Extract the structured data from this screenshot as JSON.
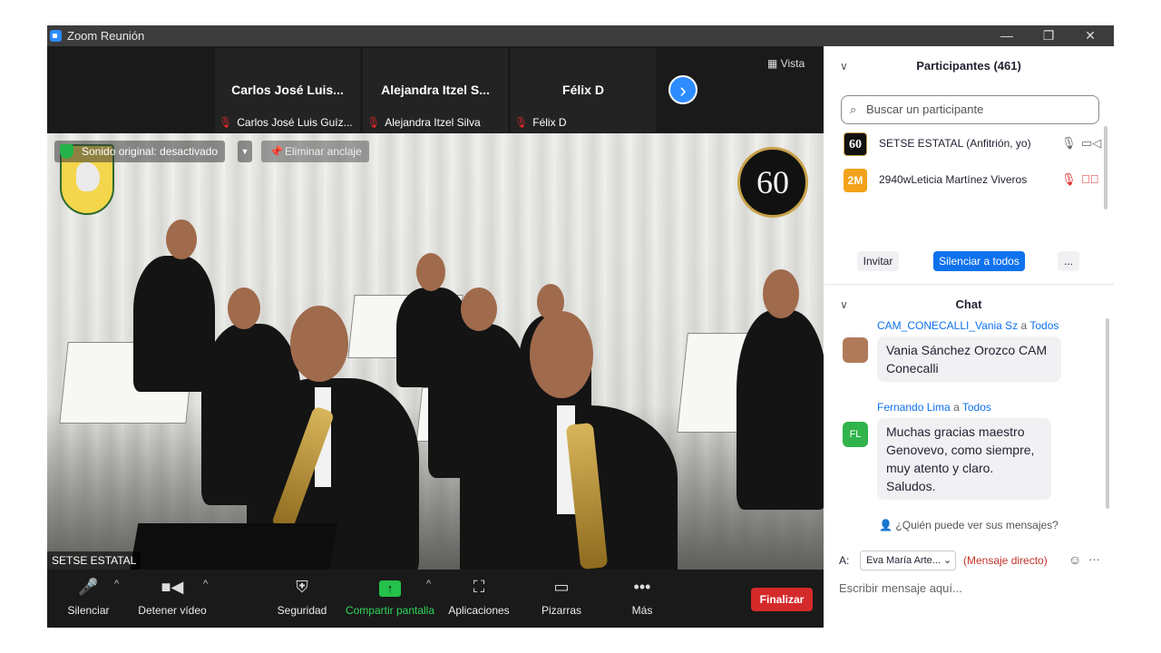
{
  "window": {
    "title": "Zoom Reunión",
    "minimize": "—",
    "maximize": "❐",
    "close": "✕"
  },
  "thumbnails": [
    {
      "name": "Carlos José Luis...",
      "label": "Carlos José Luis Guíz..."
    },
    {
      "name": "Alejandra Itzel S...",
      "label": "Alejandra Itzel Silva"
    },
    {
      "name": "Félix D",
      "label": "Félix D"
    }
  ],
  "view_label": "Vista",
  "video": {
    "sound_original": "Sonido original: desactivado",
    "unpin": "Eliminar anclaje",
    "name_tag": "SETSE ESTATAL",
    "logo_60": "60"
  },
  "toolbar": {
    "mute": "Silenciar",
    "stop_video": "Detener vídeo",
    "security": "Seguridad",
    "share": "Compartir pantalla",
    "apps": "Aplicaciones",
    "boards": "Pizarras",
    "more": "Más",
    "end": "Finalizar"
  },
  "participants": {
    "header": "Participantes (461)",
    "search_placeholder": "Buscar un participante",
    "list": [
      {
        "avatar": "60",
        "name": "SETSE ESTATAL (Anfitrión, yo)",
        "avatar_color": "#111111"
      },
      {
        "avatar": "2M",
        "name": "2940wLeticia Martínez Viveros",
        "avatar_color": "#f2a21b"
      }
    ],
    "invite": "Invitar",
    "mute_all": "Silenciar a todos",
    "more": "..."
  },
  "chat": {
    "header": "Chat",
    "messages": [
      {
        "sender": "CAM_CONECALLI_Vania Sz",
        "to": "Todos",
        "avatar": "",
        "avatar_color": "#b07a5a",
        "lines": [
          "Vania Sánchez Orozco CAM",
          "Conecalli"
        ]
      },
      {
        "sender": "Fernando Lima",
        "to": "Todos",
        "avatar": "FL",
        "avatar_color": "#2fb34a",
        "lines": [
          "Muchas gracias maestro",
          "Genovevo, como siempre,",
          "muy atento y claro.",
          "Saludos."
        ]
      }
    ],
    "a_word": "a",
    "who_can_see": "¿Quién puede ver sus mensajes?",
    "to_label": "A:",
    "recipient": "Eva María Arte...",
    "direct": "(Mensaje directo)",
    "input_placeholder": "Escribir mensaje aquí..."
  }
}
